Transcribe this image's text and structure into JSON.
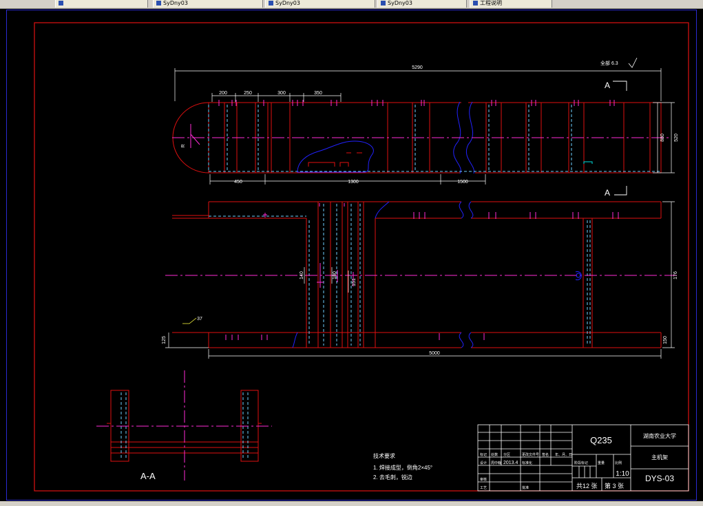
{
  "taskbar": {
    "tabs": [
      {
        "label": ""
      },
      {
        "label": "SyDny03"
      },
      {
        "label": "SyDny03"
      },
      {
        "label": "SyDny03"
      },
      {
        "label": "工程说明"
      }
    ]
  },
  "drawing": {
    "roughness": "全部 6.3",
    "section_marker_top": "A",
    "section_marker_bottom": "A",
    "section_view_label": "A-A",
    "dimensions": {
      "overall_top": "5290",
      "d200": "200",
      "d250": "250",
      "d300": "300",
      "d350": "350",
      "d450": "450",
      "d1300": "1300",
      "d1500": "1500",
      "d880": "880",
      "d520": "520",
      "r_dim": "R",
      "d5000": "5000",
      "d176": "176",
      "d150": "150",
      "d125": "125",
      "d37": "37",
      "d140": "140",
      "d180": "180",
      "d151": "151"
    },
    "tech_requirements": {
      "title": "技术要求",
      "item1": "1. 焊接成型，倒角2×45°",
      "item2": "2. 去毛刺，锐边"
    }
  },
  "title_block": {
    "material": "Q235",
    "school": "湖南农业大学",
    "part_name": "主机架",
    "drawing_no": "DYS-03",
    "scale": "1:10",
    "sheet_total": "共12 张",
    "sheet_no": "第 3 张",
    "date": "2013.4",
    "mark_label": "标记",
    "count_label": "处数",
    "zone_label": "分区",
    "change_doc_label": "更改文件号",
    "sign_label": "签名",
    "ymd_label": "年、月、日",
    "design_label": "设计",
    "std_label": "标准化",
    "review_label": "审核",
    "process_label": "工艺",
    "approve_label": "批准",
    "stage_label": "阶段标记",
    "weight_label": "重量",
    "ratio_label": "比例",
    "designer": "周中翰"
  }
}
